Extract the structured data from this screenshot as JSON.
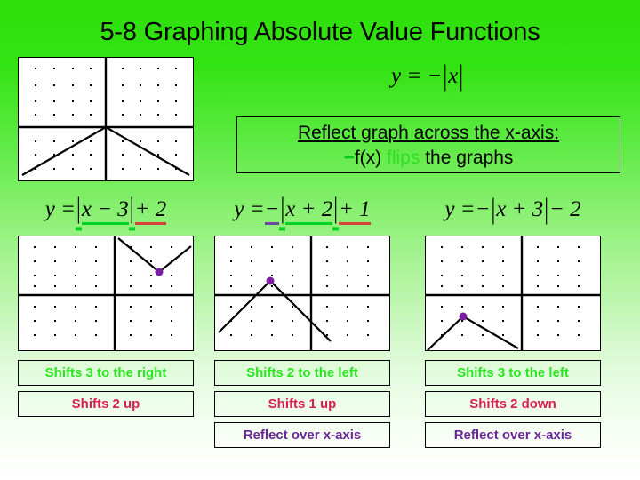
{
  "slide": {
    "title": "5-8 Graphing Absolute Value Functions",
    "background_top_color": "#2fe00c",
    "background_bottom_color": "#ffffff"
  },
  "parent_function": {
    "equation_text": "y = -|x|",
    "y": "y",
    "equals": "=",
    "minus": "−",
    "bar_open": "|",
    "x": "x",
    "bar_close": "|"
  },
  "callout": {
    "line1": "Reflect graph across the x-axis:",
    "line2_minus": "−",
    "line2_fx": "f(x)",
    "line2_flips": "flips",
    "line2_tail": "the graphs",
    "minus_color": "#00c91f",
    "flips_color": "#2ee024"
  },
  "columns": [
    {
      "equation": {
        "y": "y",
        "equals": "=",
        "lead_sign": "",
        "bar_open": "|",
        "inside": "x − 3",
        "bar_close": "|",
        "tail": "+ 2",
        "inside_underline": "#00d226",
        "tail_underline": "#d4433a",
        "lead_underline": ""
      },
      "labels": [
        {
          "text": "Shifts 3 to the right",
          "color": "#2ae520",
          "style": "lab-green"
        },
        {
          "text": "Shifts 2 up",
          "color": "#d61f55",
          "style": "lab-red"
        }
      ],
      "graph": {
        "vertex_x": 3,
        "vertex_y": 2,
        "direction": "up",
        "vertex_dot_color": "#7b1fa2"
      }
    },
    {
      "equation": {
        "y": "y",
        "equals": "=",
        "lead_sign": "−",
        "bar_open": "|",
        "inside": "x + 2",
        "bar_close": "|",
        "tail": "+ 1",
        "inside_underline": "#00d226",
        "tail_underline": "#d4433a",
        "lead_underline": "#6a4a9c"
      },
      "labels": [
        {
          "text": "Shifts 2 to the left",
          "color": "#2ae520",
          "style": "lab-green"
        },
        {
          "text": "Shifts 1 up",
          "color": "#d61f55",
          "style": "lab-red"
        },
        {
          "text": "Reflect over x-axis",
          "color": "#6a2596",
          "style": "lab-purple"
        }
      ],
      "graph": {
        "vertex_x": -2,
        "vertex_y": 1,
        "direction": "down",
        "vertex_dot_color": "#7b1fa2"
      }
    },
    {
      "equation": {
        "y": "y",
        "equals": "=",
        "lead_sign": "−",
        "bar_open": "|",
        "inside": "x + 3",
        "bar_close": "|",
        "tail": "− 2",
        "inside_underline": "",
        "tail_underline": "",
        "lead_underline": ""
      },
      "labels": [
        {
          "text": "Shifts 3 to the left",
          "color": "#2ae520",
          "style": "lab-green"
        },
        {
          "text": "Shifts 2 down",
          "color": "#d61f55",
          "style": "lab-red"
        },
        {
          "text": "Reflect over x-axis",
          "color": "#6a2596",
          "style": "lab-purple"
        }
      ],
      "graph": {
        "vertex_x": -3,
        "vertex_y": -2,
        "direction": "down",
        "vertex_dot_color": "#7b1fa2"
      }
    }
  ],
  "chart_data": [
    {
      "type": "line",
      "title": "y = -|x|",
      "function": "y = -|x|",
      "vertex": [
        0,
        0
      ],
      "direction": "down",
      "slopes": [
        1,
        -1
      ],
      "xlim": [
        -5,
        5
      ],
      "ylim": [
        -4,
        4
      ],
      "grid": true,
      "x": [
        -5,
        0,
        5
      ],
      "values": [
        -5,
        0,
        -5
      ],
      "xlabel": "",
      "ylabel": ""
    },
    {
      "type": "line",
      "title": "y = |x - 3| + 2",
      "function": "y = |x - 3| + 2",
      "vertex": [
        3,
        2
      ],
      "direction": "up",
      "slopes": [
        -1,
        1
      ],
      "xlim": [
        -5,
        5
      ],
      "ylim": [
        -4,
        4
      ],
      "grid": true,
      "x": [
        1,
        3,
        5
      ],
      "values": [
        4,
        2,
        4
      ],
      "xlabel": "",
      "ylabel": ""
    },
    {
      "type": "line",
      "title": "y = -|x + 2| + 1",
      "function": "y = -|x + 2| + 1",
      "vertex": [
        -2,
        1
      ],
      "direction": "down",
      "slopes": [
        1,
        -1
      ],
      "xlim": [
        -5,
        5
      ],
      "ylim": [
        -4,
        4
      ],
      "grid": true,
      "x": [
        -5,
        -2,
        4
      ],
      "values": [
        -2,
        1,
        -5
      ],
      "xlabel": "",
      "ylabel": ""
    },
    {
      "type": "line",
      "title": "y = -|x + 3| - 2",
      "function": "y = -|x + 3| - 2",
      "vertex": [
        -3,
        -2
      ],
      "direction": "down",
      "slopes": [
        1,
        -1
      ],
      "xlim": [
        -5,
        5
      ],
      "ylim": [
        -4,
        4
      ],
      "grid": true,
      "x": [
        -5,
        -3,
        -1
      ],
      "values": [
        -4,
        -2,
        -4
      ],
      "xlabel": "",
      "ylabel": ""
    }
  ]
}
